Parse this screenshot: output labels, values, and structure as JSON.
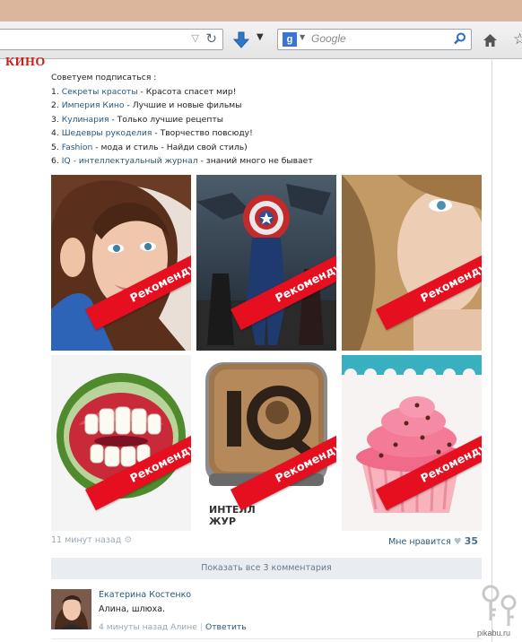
{
  "browser": {
    "search_placeholder": "Google",
    "search_engine_letter": "g"
  },
  "page": {
    "brand": "КИНО",
    "intro": "Советуем подписаться :",
    "recommendations": [
      {
        "num": "1.",
        "link": "Секреты красоты",
        "desc": " - Красота спасет мир!"
      },
      {
        "num": "2.",
        "link": "Империя Кино",
        "desc": " - Лучшие и новые фильмы"
      },
      {
        "num": "3.",
        "link": "Кулинария",
        "desc": " - Только лучшие рецепты"
      },
      {
        "num": "4.",
        "link": "Шедевры рукоделия",
        "desc": " - Творчество повсюду!"
      },
      {
        "num": "5.",
        "link": "Fashion",
        "desc": " - мода и стиль - Найди свой стиль)"
      },
      {
        "num": "6.",
        "link": "IQ - интеллектуальный журнал",
        "desc": " - знаний много не бывает"
      }
    ],
    "tiles": [
      {
        "ribbon": "Рекомендуем",
        "image": "woman-portrait-brunette"
      },
      {
        "ribbon": "Рекомендуем",
        "image": "captain-america-poster"
      },
      {
        "ribbon": "Рекомендуем",
        "image": "woman-portrait-blonde"
      },
      {
        "ribbon": "Рекомендуем",
        "image": "watermelon-mouth"
      },
      {
        "ribbon": "Рекомендуем",
        "image": "iq-app-icon"
      },
      {
        "ribbon": "Рекомендуем",
        "image": "pink-cupcake"
      }
    ],
    "post_time": "11 минут назад",
    "like_label": "Мне нравится",
    "like_count": "35",
    "show_comments": "Показать все 3 комментария",
    "comment": {
      "author": "Екатерина Костенко",
      "text": "Алина, шлюха.",
      "time": "4 минуты назад Алине",
      "reply": "Ответить"
    },
    "watermark": "pikabu.ru"
  },
  "colors": {
    "link": "#2b587a",
    "ribbon": "#e50f20",
    "brand": "#d21b1b",
    "muted": "#9aa7b4"
  }
}
